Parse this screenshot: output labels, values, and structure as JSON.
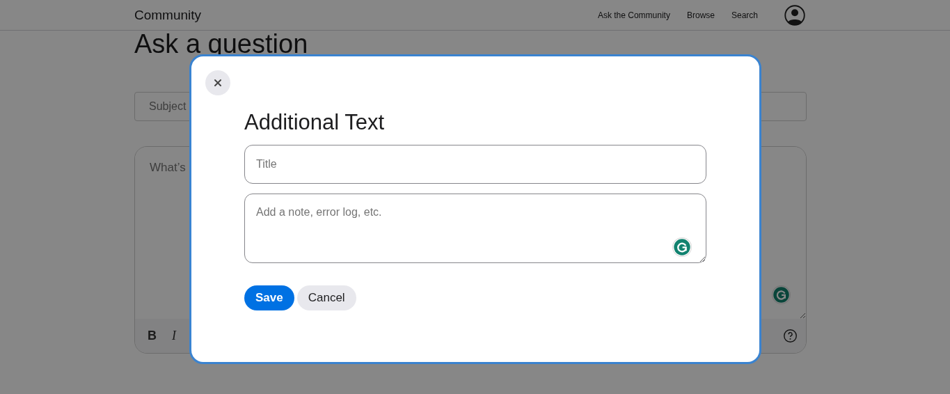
{
  "header": {
    "brand": "Community",
    "nav": [
      {
        "label": "Ask the Community"
      },
      {
        "label": "Browse"
      },
      {
        "label": "Search"
      }
    ]
  },
  "page": {
    "title": "Ask a question",
    "subject_field": {
      "placeholder": "Subject"
    },
    "body_field": {
      "placeholder": "What’s"
    },
    "toolbar": [
      {
        "label": "B",
        "kind": "bold"
      },
      {
        "label": "I",
        "kind": "italic"
      }
    ]
  },
  "dialog": {
    "title": "Additional Text",
    "fields": [
      {
        "kind": "input",
        "placeholder": "Title"
      },
      {
        "kind": "textarea",
        "placeholder": "Add a note, error log, etc."
      }
    ],
    "buttons": [
      {
        "label": "Save",
        "kind": "primary"
      },
      {
        "label": "Cancel",
        "kind": "secondary"
      }
    ]
  }
}
